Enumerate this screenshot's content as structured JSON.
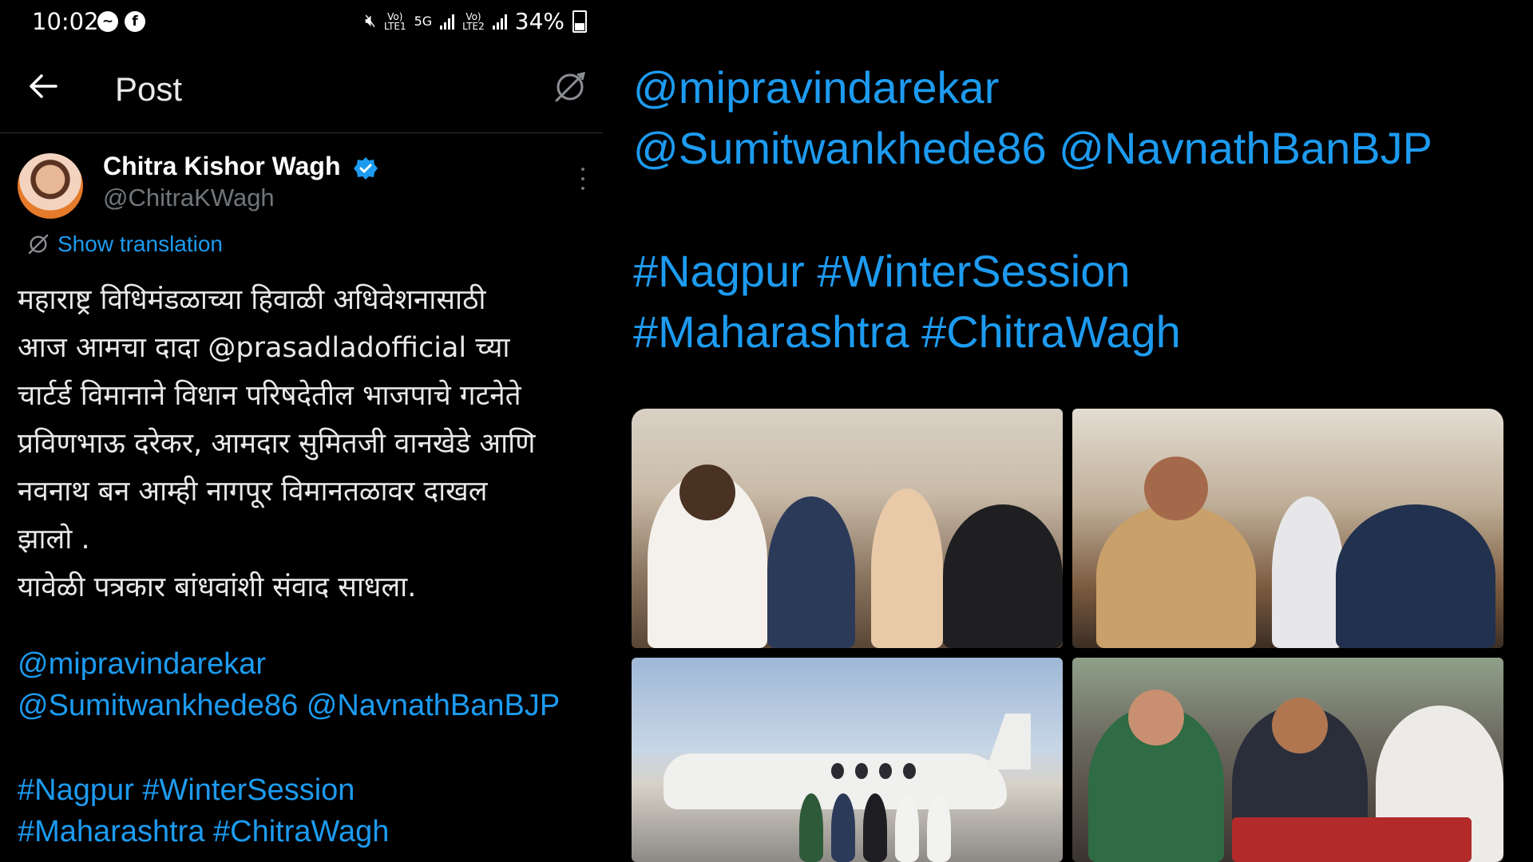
{
  "status_bar": {
    "time": "10:02",
    "battery": "34%",
    "net1": "Vo)\nLTE1",
    "net2": "5G",
    "net3": "Vo)\nLTE2"
  },
  "header": {
    "title": "Post"
  },
  "tweet": {
    "author_name": "Chitra Kishor Wagh",
    "author_handle": "@ChitraKWagh",
    "show_translation": "Show translation",
    "body_lines": [
      "महाराष्ट्र विधिमंडळाच्या हिवाळी अधिवेशनासाठी",
      "आज आमचा दादा @prasadladofficial  च्या",
      "चार्टर्ड विमानाने विधान परिषदेतील भाजपाचे गटनेते",
      "प्रविणभाऊ दरेकर, आमदार सुमितजी वानखेडे आणि",
      "नवनाथ बन आम्ही नागपूर विमानतळावर दाखल",
      "झालो .",
      "यावेळी पत्रकार बांधवांशी संवाद साधला."
    ],
    "mentions_line1": "@mipravindarekar",
    "mentions_line2": "@Sumitwankhede86 @NavnathBanBJP",
    "hashtags_line1": "#Nagpur #WinterSession",
    "hashtags_line2": "#Maharashtra #ChitraWagh"
  },
  "colors": {
    "background": "#000000",
    "link": "#1d9bf0",
    "text": "#e7e9ea",
    "muted": "#71767b",
    "verified": "#1d9bf0"
  },
  "icons": {
    "back": "arrow-left-icon",
    "sync": "sync-off-icon",
    "verified": "verified-badge-icon",
    "more": "more-vertical-icon",
    "translate": "translate-icon"
  }
}
